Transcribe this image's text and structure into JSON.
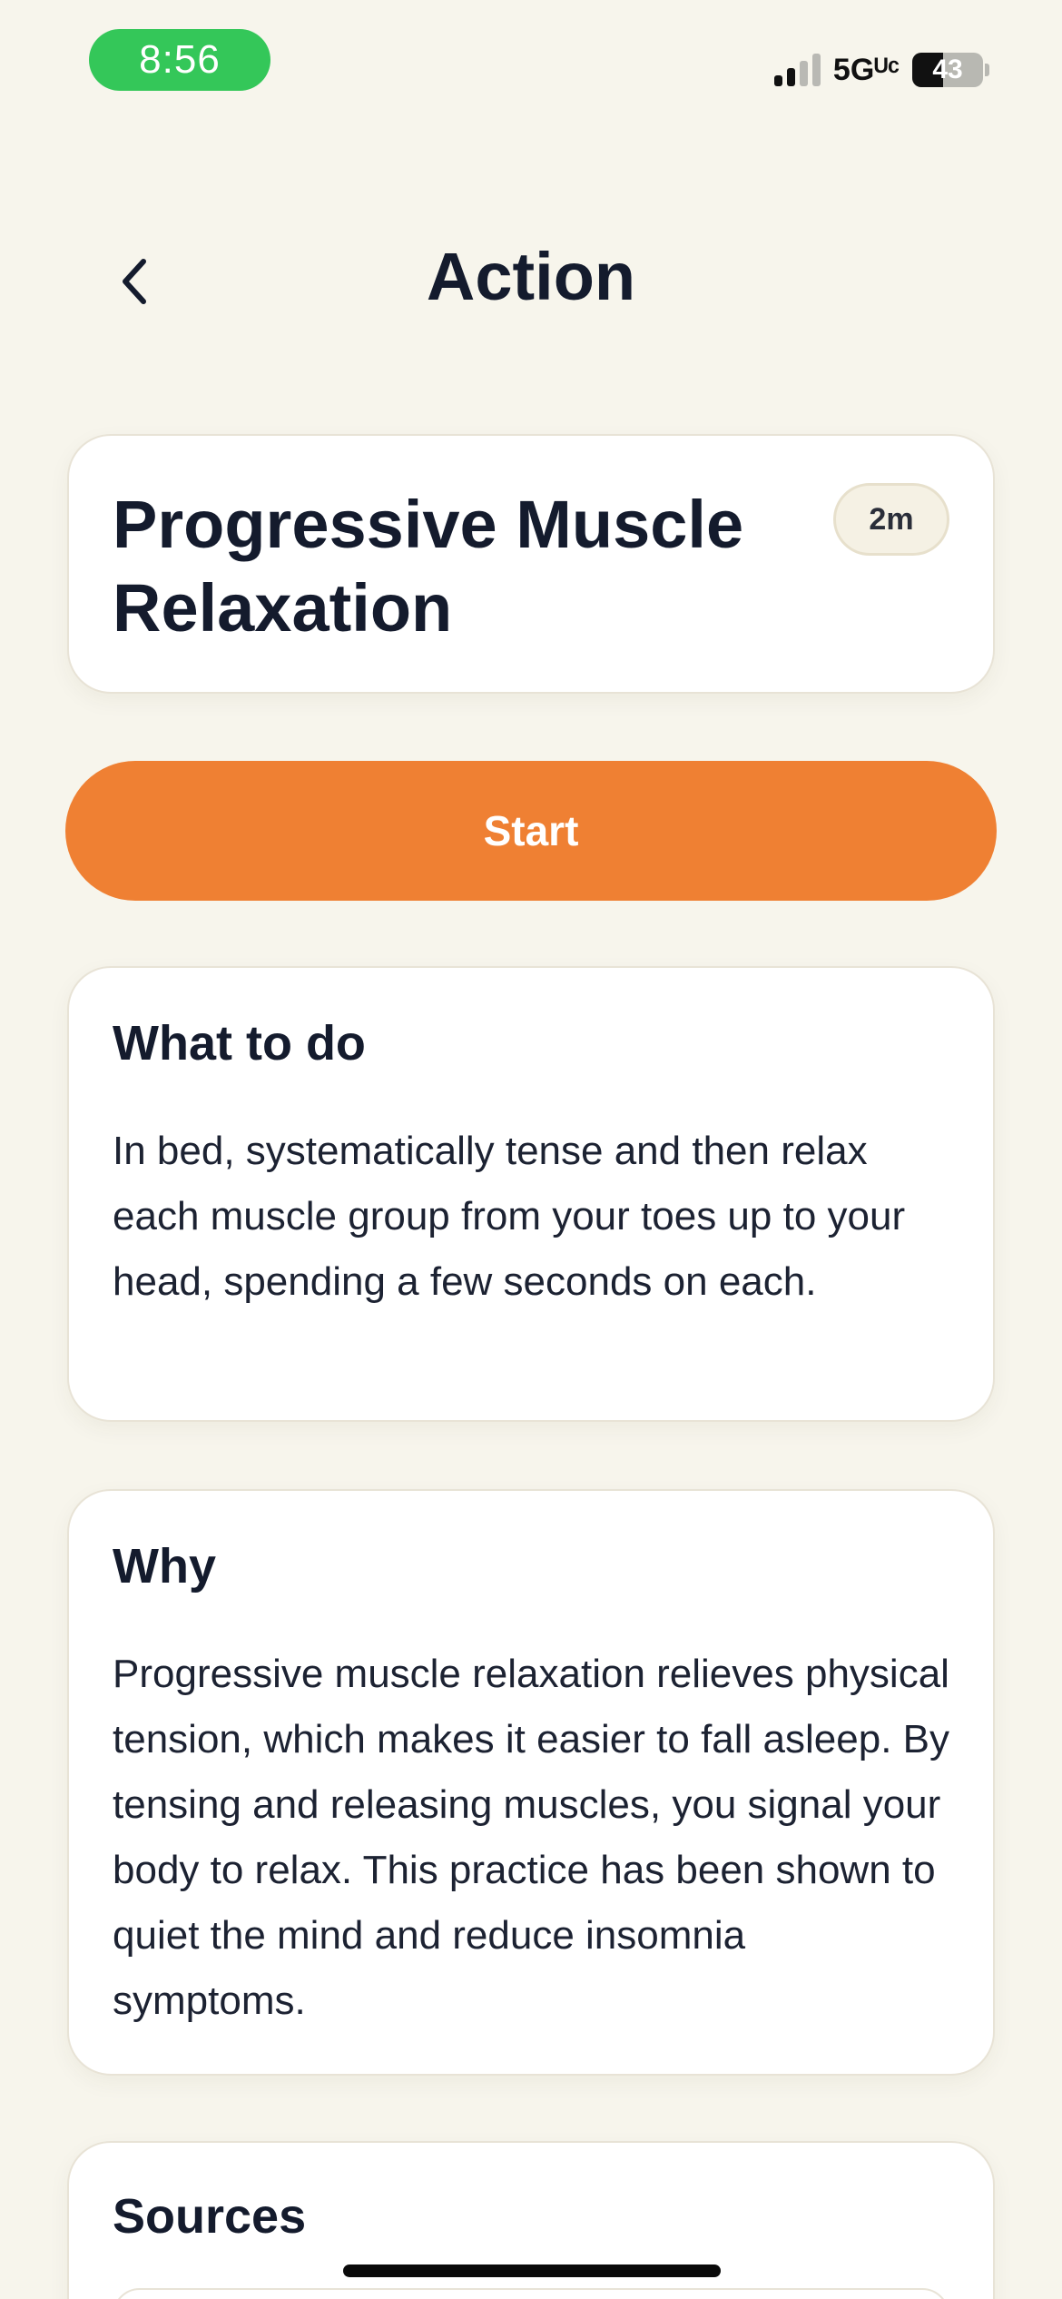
{
  "status_bar": {
    "time": "8:56",
    "network": "5Gᵁᶜ",
    "battery_level": "43",
    "colors": {
      "time_pill": "#34c759"
    }
  },
  "header": {
    "back_icon": "chevron-left-icon",
    "title": "Action"
  },
  "action": {
    "title": "Progressive Muscle Relaxation",
    "duration": "2m"
  },
  "start_button": {
    "label": "Start",
    "color": "#ef8033"
  },
  "what_to_do": {
    "heading": "What to do",
    "body": "In bed, systematically tense and then relax each muscle group from your toes up to your head, spending a few seconds on each."
  },
  "why": {
    "heading": "Why",
    "body": "Progressive muscle relaxation relieves physical tension, which makes it easier to fall asleep. By tensing and releasing muscles, you signal your body to relax. This practice has been shown to quiet the mind and reduce insomnia symptoms."
  },
  "sources": {
    "heading": "Sources"
  }
}
